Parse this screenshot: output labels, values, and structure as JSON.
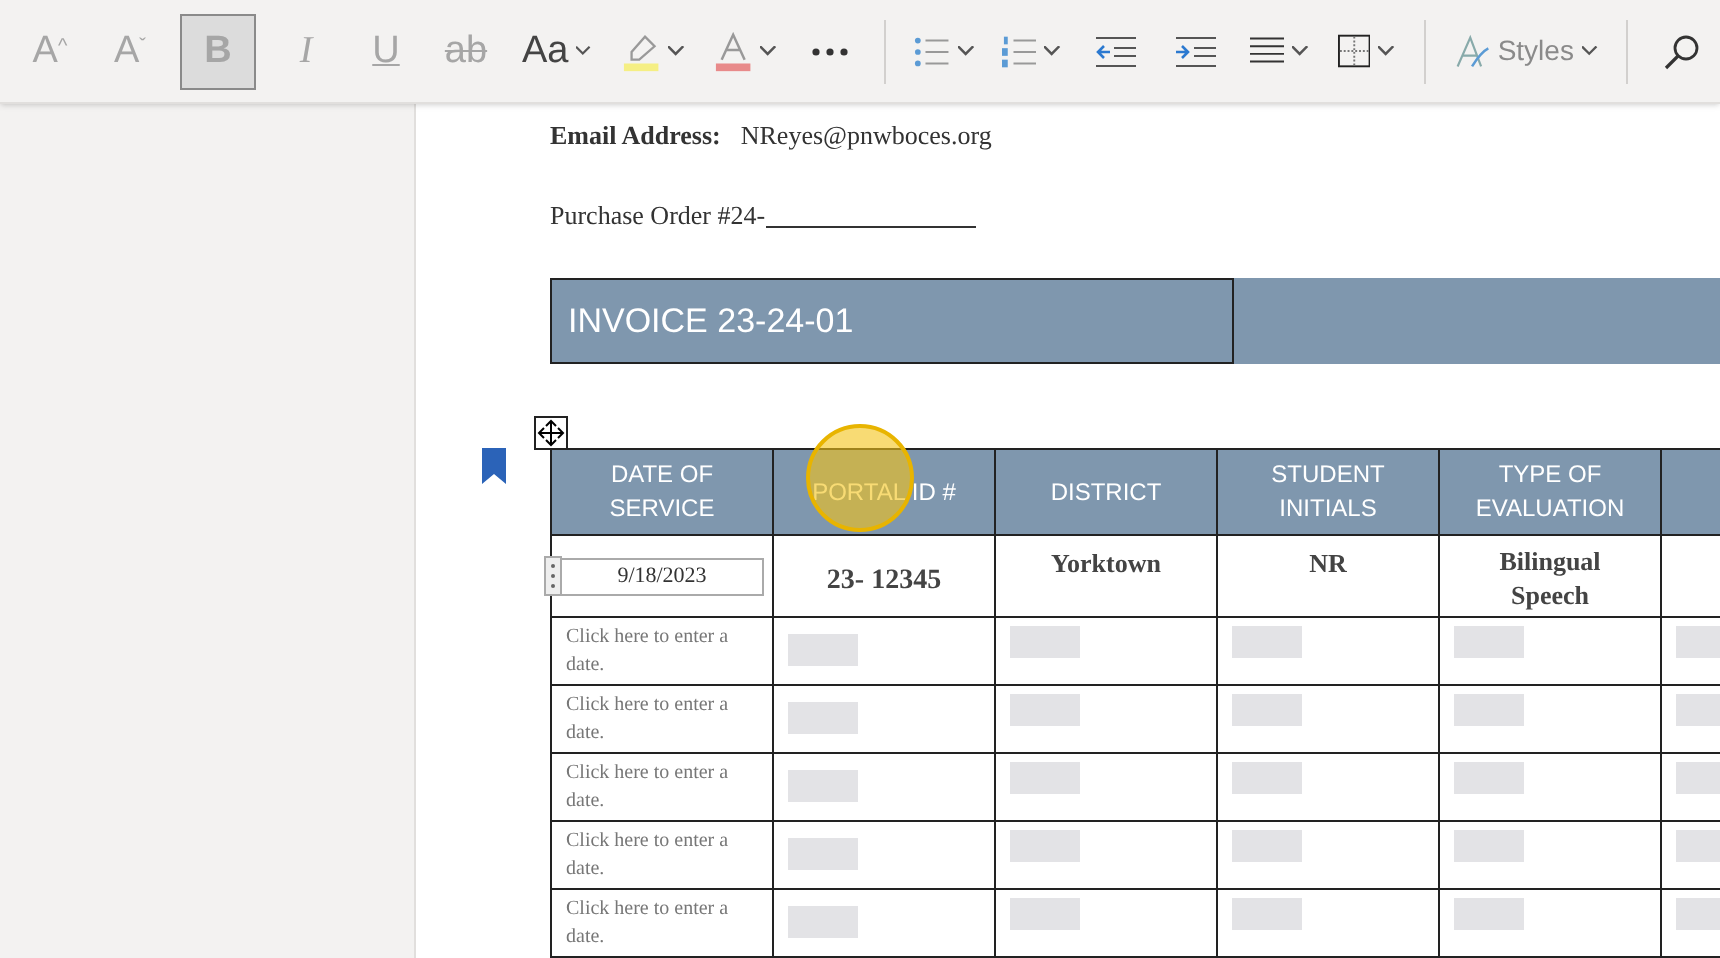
{
  "toolbar": {
    "items": [
      {
        "kind": "grow",
        "label": "A",
        "sup": "^",
        "selected": false,
        "disabled": true
      },
      {
        "kind": "shrink",
        "label": "A",
        "sup": "ˇ",
        "selected": false,
        "disabled": true
      },
      {
        "kind": "bold",
        "label": "B",
        "selected": true,
        "disabled": true
      },
      {
        "kind": "italic",
        "label": "I",
        "selected": false,
        "disabled": true
      },
      {
        "kind": "underline",
        "label": "U",
        "selected": false,
        "disabled": true
      },
      {
        "kind": "strike",
        "label": "ab",
        "selected": false,
        "disabled": true
      },
      {
        "kind": "case",
        "label": "Aa",
        "disabled": false
      },
      {
        "kind": "highlight",
        "color": "#f5ef84"
      },
      {
        "kind": "fontcolor",
        "color": "#e88a8a"
      },
      {
        "kind": "more"
      },
      {
        "kind": "sep"
      },
      {
        "kind": "bullets"
      },
      {
        "kind": "numbering"
      },
      {
        "kind": "outdent"
      },
      {
        "kind": "indent"
      },
      {
        "kind": "align"
      },
      {
        "kind": "borders"
      },
      {
        "kind": "sep"
      },
      {
        "kind": "styles",
        "label": "Styles"
      },
      {
        "kind": "sep"
      },
      {
        "kind": "search"
      }
    ]
  },
  "document": {
    "email": {
      "label": "Email Address:",
      "value": "NReyes@pnwboces.org"
    },
    "purchase_order": "Purchase Order #24-",
    "invoice_title": "INVOICE 23-24-01",
    "table": {
      "columns": [
        "DATE OF SERVICE",
        "PORTAL ID #",
        "DISTRICT",
        "STUDENT INITIALS",
        "TYPE OF EVALUATION"
      ],
      "rows": [
        {
          "date": "9/18/2023",
          "portal_id": "23- 12345",
          "district": "Yorktown",
          "initials": "NR",
          "evaluation": "Bilingual Speech"
        },
        {
          "date_placeholder": "Click here to enter a date."
        },
        {
          "date_placeholder": "Click here to enter a date."
        },
        {
          "date_placeholder": "Click here to enter a date."
        },
        {
          "date_placeholder": "Click here to enter a date."
        },
        {
          "date_placeholder": "Click here to enter a date."
        }
      ]
    }
  }
}
